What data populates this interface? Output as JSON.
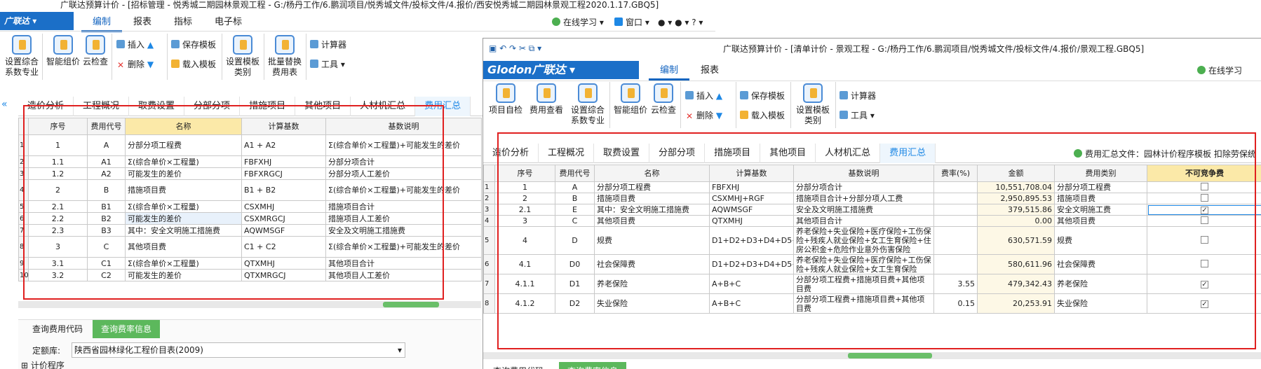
{
  "back_window": {
    "title": "广联达预算计价 - [招标管理 - 悦秀城二期园林景观工程 - G:/杨丹工作/6.鹏润项目/悦秀城文件/投标文件/4.报价/西安悦秀城二期园林景观工程2020.1.17.GBQ5]",
    "logo": "广联达",
    "menu": [
      "编制",
      "报表",
      "指标",
      "电子标"
    ],
    "right_tools": {
      "online": "在线学习",
      "window": "窗口"
    },
    "ribbon": {
      "big": [
        {
          "label": "设置综合\n系数专业"
        },
        {
          "label": "智能组价"
        },
        {
          "label": "云检查"
        },
        {
          "label": "设置模板\n类别"
        },
        {
          "label": "批量替换\n费用表"
        }
      ],
      "small": [
        "插入",
        "删除",
        "保存模板",
        "载入模板",
        "计算器",
        "工具"
      ]
    },
    "tabs": [
      "造价分析",
      "工程概况",
      "取费设置",
      "分部分项",
      "措施项目",
      "其他项目",
      "人材机汇总",
      "费用汇总"
    ],
    "active_tab": "费用汇总",
    "table": {
      "headers": [
        "序号",
        "费用代号",
        "名称",
        "计算基数",
        "基数说明"
      ],
      "rows": [
        {
          "rn": "1",
          "seq": "1",
          "code": "A",
          "name": "分部分项工程费",
          "base": "A1 + A2",
          "desc": "Σ(综合单价×工程量)+可能发生的差价"
        },
        {
          "rn": "2",
          "seq": "1.1",
          "code": "A1",
          "name": "Σ(综合单价×工程量)",
          "base": "FBFXHJ",
          "desc": "分部分项合计"
        },
        {
          "rn": "3",
          "seq": "1.2",
          "code": "A2",
          "name": "可能发生的差价",
          "base": "FBFXRGCJ",
          "desc": "分部分项人工差价"
        },
        {
          "rn": "4",
          "seq": "2",
          "code": "B",
          "name": "措施项目费",
          "base": "B1 + B2",
          "desc": "Σ(综合单价×工程量)+可能发生的差价"
        },
        {
          "rn": "5",
          "seq": "2.1",
          "code": "B1",
          "name": "Σ(综合单价×工程量)",
          "base": "CSXMHJ",
          "desc": "措施项目合计"
        },
        {
          "rn": "6",
          "seq": "2.2",
          "code": "B2",
          "name": "可能发生的差价",
          "base": "CSXMRGCJ",
          "desc": "措施项目人工差价"
        },
        {
          "rn": "7",
          "seq": "2.3",
          "code": "B3",
          "name": "其中：安全文明施工措施费",
          "base": "AQWMSGF",
          "desc": "安全及文明施工措施费"
        },
        {
          "rn": "8",
          "seq": "3",
          "code": "C",
          "name": "其他项目费",
          "base": "C1 + C2",
          "desc": "Σ(综合单价×工程量)+可能发生的差价"
        },
        {
          "rn": "9",
          "seq": "3.1",
          "code": "C1",
          "name": "Σ(综合单价×工程量)",
          "base": "QTXMHJ",
          "desc": "其他项目合计"
        },
        {
          "rn": "10",
          "seq": "3.2",
          "code": "C2",
          "name": "可能发生的差价",
          "base": "QTXMRGCJ",
          "desc": "其他项目人工差价"
        }
      ]
    },
    "bottom_tabs": [
      "查询费用代码",
      "查询费率信息"
    ],
    "quota_label": "定额库:",
    "quota_value": "陕西省园林绿化工程价目表(2009)",
    "tree_item": "计价程序"
  },
  "front_window": {
    "title": "广联达预算计价 - [清单计价 - 景观工程 - G:/杨丹工作/6.鹏润项目/悦秀城文件/投标文件/4.报价/景观工程.GBQ5]",
    "logo": "Glodon广联达",
    "menu": [
      "编制",
      "报表"
    ],
    "right_tools": {
      "online": "在线学习"
    },
    "ribbon": {
      "big": [
        {
          "label": "项目自检"
        },
        {
          "label": "费用查看"
        },
        {
          "label": "设置综合\n系数专业"
        },
        {
          "label": "智能组价"
        },
        {
          "label": "云检查"
        },
        {
          "label": "设置模板\n类别"
        }
      ],
      "small": [
        "插入",
        "删除",
        "保存模板",
        "载入模板",
        "计算器",
        "工具"
      ]
    },
    "tabs": [
      "造价分析",
      "工程概况",
      "取费设置",
      "分部分项",
      "措施项目",
      "其他项目",
      "人材机汇总",
      "费用汇总"
    ],
    "active_tab": "费用汇总",
    "fee_file": "费用汇总文件：园林计价程序模板",
    "fee_extra": "扣除劳保统",
    "table": {
      "headers": [
        "序号",
        "费用代号",
        "名称",
        "计算基数",
        "基数说明",
        "费率(%)",
        "金额",
        "费用类别",
        "不可竞争费"
      ],
      "rows": [
        {
          "rn": "1",
          "seq": "1",
          "code": "A",
          "name": "分部分项工程费",
          "base": "FBFXHJ",
          "desc": "分部分项合计",
          "rate": "",
          "amount": "10,551,708.04",
          "category": "分部分项工程费",
          "check": false
        },
        {
          "rn": "2",
          "seq": "2",
          "code": "B",
          "name": "措施项目费",
          "base": "CSXMHJ+RGF",
          "desc": "措施项目合计+分部分项人工费",
          "rate": "",
          "amount": "2,950,895.53",
          "category": "措施项目费",
          "check": false
        },
        {
          "rn": "3",
          "seq": "2.1",
          "code": "E",
          "name": "其中：安全文明施工措施费",
          "base": "AQWMSGF",
          "desc": "安全及文明施工措施费",
          "rate": "",
          "amount": "379,515.86",
          "category": "安全文明施工费",
          "check": true
        },
        {
          "rn": "4",
          "seq": "3",
          "code": "C",
          "name": "其他项目费",
          "base": "QTXMHJ",
          "desc": "其他项目合计",
          "rate": "",
          "amount": "0.00",
          "category": "其他项目费",
          "check": false
        },
        {
          "rn": "5",
          "seq": "4",
          "code": "D",
          "name": "规费",
          "base": "D1+D2+D3+D4+D5+D6+D7+D8",
          "desc": "养老保险+失业保险+医疗保险+工伤保险+残疾人就业保险+女工生育保险+住房公积金+危险作业意外伤害保险",
          "rate": "",
          "amount": "630,571.59",
          "category": "规费",
          "check": false
        },
        {
          "rn": "6",
          "seq": "4.1",
          "code": "D0",
          "name": "社会保障费",
          "base": "D1+D2+D3+D4+D5+D6",
          "desc": "养老保险+失业保险+医疗保险+工伤保险+残疾人就业保险+女工生育保险",
          "rate": "",
          "amount": "580,611.96",
          "category": "社会保障费",
          "check": false
        },
        {
          "rn": "7",
          "seq": "4.1.1",
          "code": "D1",
          "name": "养老保险",
          "base": "A+B+C",
          "desc": "分部分项工程费+措施项目费+其他项目费",
          "rate": "3.55",
          "amount": "479,342.43",
          "category": "养老保险",
          "check": true
        },
        {
          "rn": "8",
          "seq": "4.1.2",
          "code": "D2",
          "name": "失业保险",
          "base": "A+B+C",
          "desc": "分部分项工程费+措施项目费+其他项目费",
          "rate": "0.15",
          "amount": "20,253.91",
          "category": "失业保险",
          "check": true
        }
      ]
    },
    "bottom_tabs": [
      "查询费用代码",
      "查询费率信息"
    ]
  },
  "colors": {
    "accent": "#1e88e5",
    "logo_bg": "#1b6fc8",
    "highlight": "#e02020",
    "green_tab": "#5cb85c"
  }
}
